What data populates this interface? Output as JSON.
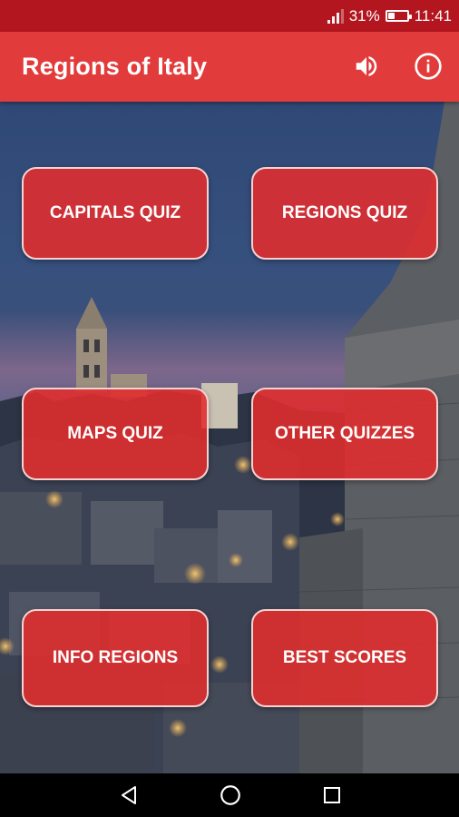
{
  "status": {
    "battery": "31%",
    "time": "11:41",
    "battery_level": 0.31
  },
  "appbar": {
    "title": "Regions of Italy"
  },
  "icons": {
    "sound": "volume-icon",
    "info": "info-icon"
  },
  "menu": [
    {
      "label": "CAPITALS QUIZ"
    },
    {
      "label": "REGIONS QUIZ"
    },
    {
      "label": "MAPS QUIZ"
    },
    {
      "label": "OTHER QUIZZES"
    },
    {
      "label": "INFO REGIONS"
    },
    {
      "label": "BEST SCORES"
    }
  ],
  "colors": {
    "status_bar": "#b3161f",
    "app_bar": "#e23b3b",
    "button": "#e32c2c"
  }
}
